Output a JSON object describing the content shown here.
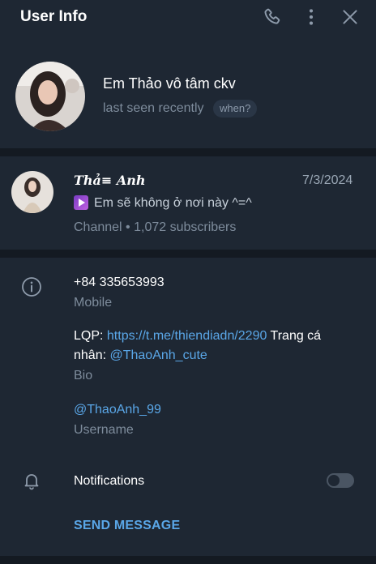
{
  "window": {
    "title": "User Info"
  },
  "header_actions": {
    "call_icon": "phone-icon",
    "more_icon": "more-vertical-icon",
    "close_icon": "close-icon"
  },
  "profile": {
    "name": "Em Thảo vô tâm ckv",
    "status": "last seen recently",
    "when_label": "when?"
  },
  "channel": {
    "name": "𝑻𝒉ả≡ 𝑨𝒏𝒉",
    "date": "7/3/2024",
    "message": "Em sẽ không ở nơi này ^=^",
    "subtitle": "Channel • 1,072 subscribers"
  },
  "info": {
    "phone": "+84 335653993",
    "phone_label": "Mobile",
    "bio_prefix": "LQP: ",
    "bio_link": "https://t.me/thiendiadn/2290",
    "bio_middle": " Trang cá",
    "bio_line2_prefix": "nhân: ",
    "bio_mention": "@ThaoAnh_cute",
    "bio_label": "Bio",
    "username": "@ThaoAnh_99",
    "username_label": "Username"
  },
  "notifications": {
    "label": "Notifications",
    "enabled": false
  },
  "send_message_label": "SEND MESSAGE",
  "colors": {
    "background": "#1e2733",
    "divider": "#141a22",
    "accent_link": "#5aa7e8",
    "muted_text": "#7e8c9c"
  }
}
